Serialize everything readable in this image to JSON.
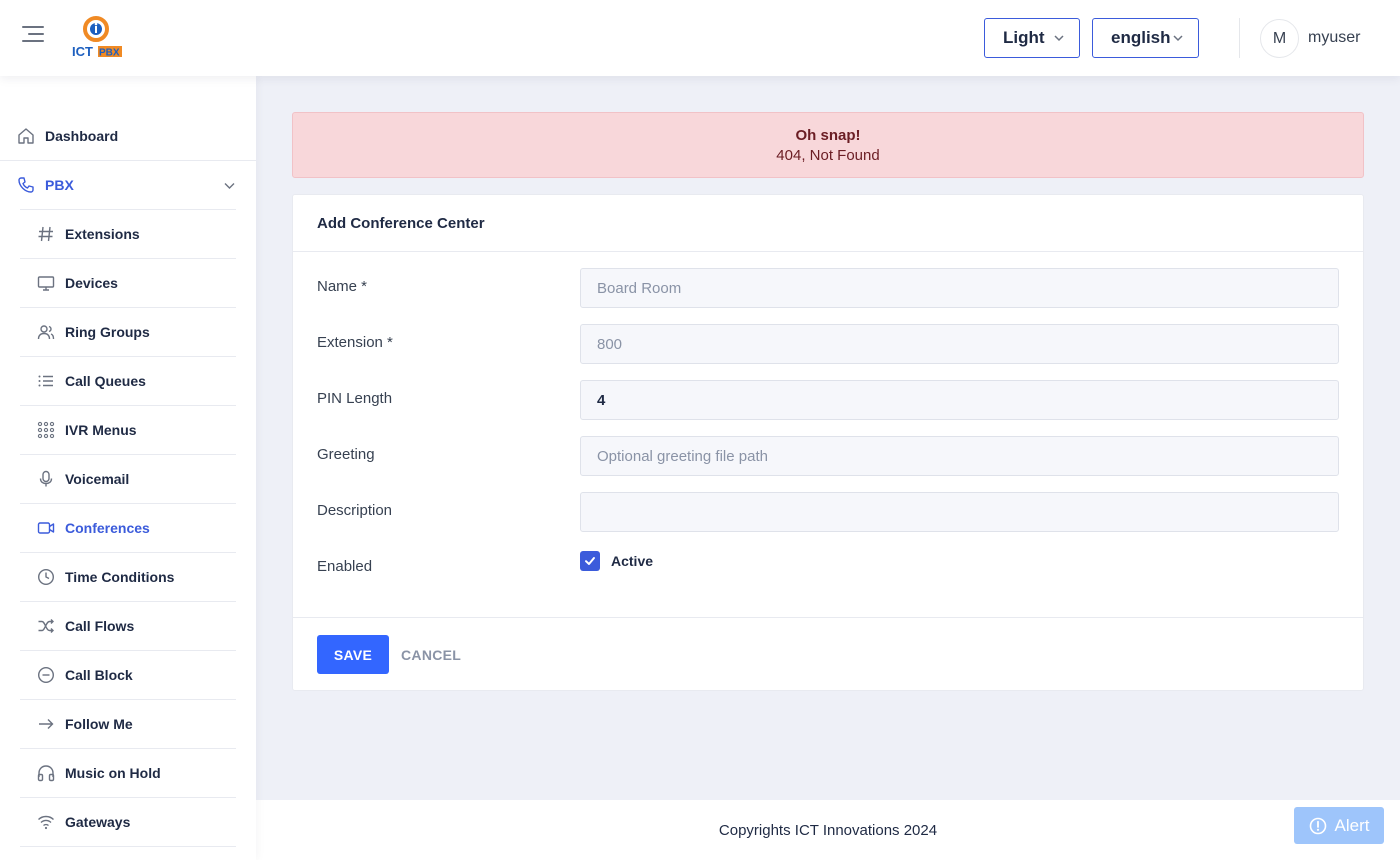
{
  "header": {
    "logo_text": "ICTPBX",
    "theme_value": "Light",
    "language_value": "english",
    "avatar_initial": "M",
    "username": "myuser"
  },
  "sidebar": {
    "items": [
      {
        "label": "Dashboard",
        "icon": "home-icon"
      },
      {
        "label": "PBX",
        "icon": "phone-icon"
      },
      {
        "label": "Extensions",
        "icon": "hash-icon"
      },
      {
        "label": "Devices",
        "icon": "monitor-icon"
      },
      {
        "label": "Ring Groups",
        "icon": "users-icon"
      },
      {
        "label": "Call Queues",
        "icon": "list-icon"
      },
      {
        "label": "IVR Menus",
        "icon": "grid-icon"
      },
      {
        "label": "Voicemail",
        "icon": "microphone-icon"
      },
      {
        "label": "Conferences",
        "icon": "video-icon"
      },
      {
        "label": "Time Conditions",
        "icon": "clock-icon"
      },
      {
        "label": "Call Flows",
        "icon": "shuffle-icon"
      },
      {
        "label": "Call Block",
        "icon": "minus-circle-icon"
      },
      {
        "label": "Follow Me",
        "icon": "arrow-right-icon"
      },
      {
        "label": "Music on Hold",
        "icon": "headphones-icon"
      },
      {
        "label": "Gateways",
        "icon": "wifi-icon"
      }
    ]
  },
  "alert": {
    "title": "Oh snap!",
    "message": "404, Not Found"
  },
  "form": {
    "title": "Add Conference Center",
    "name": {
      "label": "Name *",
      "value": "",
      "placeholder": "Board Room"
    },
    "extension": {
      "label": "Extension *",
      "value": "",
      "placeholder": "800"
    },
    "pin_length": {
      "label": "PIN Length",
      "value": "4",
      "placeholder": ""
    },
    "greeting": {
      "label": "Greeting",
      "value": "",
      "placeholder": "Optional greeting file path"
    },
    "description": {
      "label": "Description",
      "value": "",
      "placeholder": ""
    },
    "enabled": {
      "label": "Enabled",
      "checkbox_label": "Active",
      "checked": true
    },
    "save_label": "SAVE",
    "cancel_label": "CANCEL"
  },
  "footer": {
    "text": "Copyrights ICT Innovations 2024"
  },
  "alert_button": {
    "label": "Alert"
  },
  "colors": {
    "accent": "#3366ff",
    "active_nav": "#3b5bdb",
    "alert_bg": "#f8d7da",
    "alert_text": "#6b1d24",
    "alert_fab": "#9ec5fb"
  }
}
